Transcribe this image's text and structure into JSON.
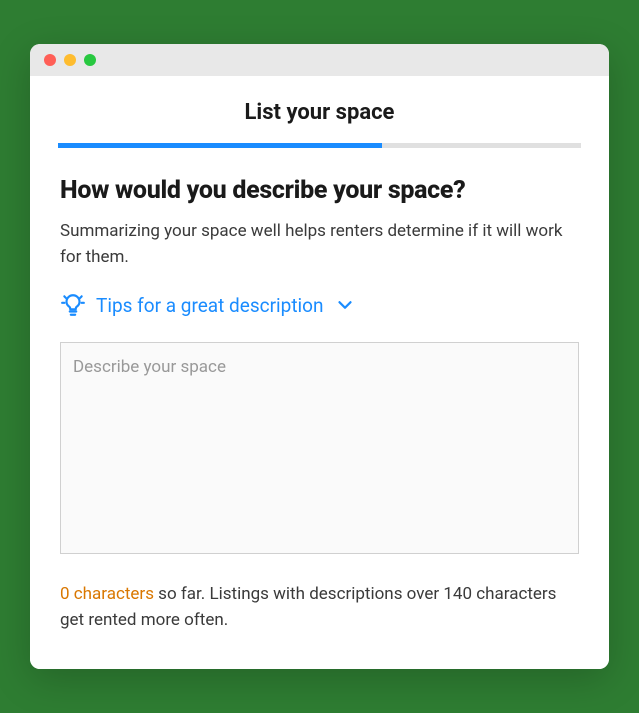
{
  "header": {
    "title": "List your space"
  },
  "progress": {
    "percent": 62
  },
  "step": {
    "heading": "How would you describe your space?",
    "subheading": "Summarizing your space well helps renters determine if it will work for them.",
    "tips_label": "Tips for a great description"
  },
  "form": {
    "description_placeholder": "Describe your space",
    "description_value": ""
  },
  "helper": {
    "count_text": "0 characters",
    "rest_text": " so far. Listings with descriptions over 140 characters get rented more often."
  }
}
